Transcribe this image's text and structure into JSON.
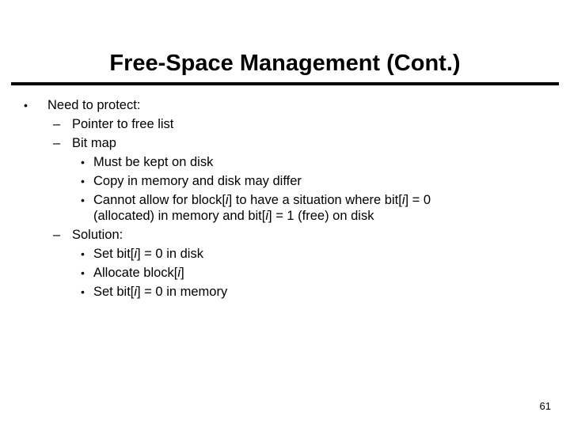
{
  "slide": {
    "title": "Free-Space Management (Cont.)",
    "page_number": "61",
    "bullets": {
      "b1": {
        "marker": "•",
        "text": "Need to protect:"
      },
      "b1_1": {
        "marker": "–",
        "text": "Pointer to free list"
      },
      "b1_2": {
        "marker": "–",
        "text": "Bit map"
      },
      "b1_2_1": {
        "marker": "•",
        "text": "Must be kept on disk"
      },
      "b1_2_2": {
        "marker": "•",
        "text": "Copy in memory and disk may differ"
      },
      "b1_2_3": {
        "marker": "•",
        "line1_pre": "Cannot allow for block[",
        "line1_var1": "i",
        "line1_mid": "] to have a situation where bit[",
        "line1_var2": "i",
        "line1_post": "] = 0",
        "line2_pre": "(allocated) in memory and bit[",
        "line2_var": "i",
        "line2_post": "] = 1 (free) on disk"
      },
      "b1_3": {
        "marker": "–",
        "text": "Solution:"
      },
      "b1_3_1": {
        "marker": "•",
        "pre": "Set bit[",
        "var": "i",
        "post": "] = 0 in disk"
      },
      "b1_3_2": {
        "marker": "•",
        "pre": "Allocate block[",
        "var": "i",
        "post": "]"
      },
      "b1_3_3": {
        "marker": "•",
        "pre": "Set bit[",
        "var": "i",
        "post": "] = 0 in memory"
      }
    }
  }
}
